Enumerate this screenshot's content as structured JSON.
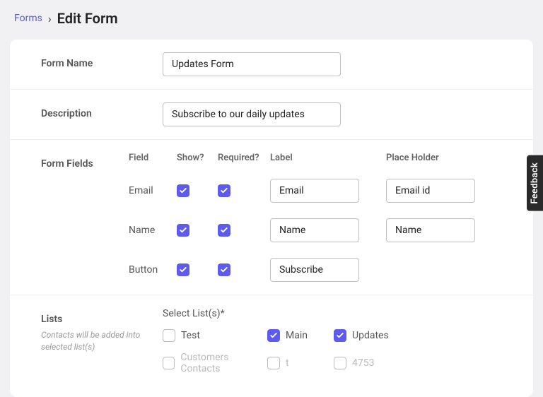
{
  "breadcrumb": {
    "root": "Forms",
    "current": "Edit Form"
  },
  "form_name": {
    "label": "Form Name",
    "value": "Updates Form"
  },
  "description": {
    "label": "Description",
    "value": "Subscribe to our daily updates"
  },
  "form_fields": {
    "section_label": "Form Fields",
    "headers": {
      "field": "Field",
      "show": "Show?",
      "required": "Required?",
      "label": "Label",
      "placeholder": "Place Holder"
    },
    "rows": [
      {
        "field": "Email",
        "show": true,
        "required": true,
        "label": "Email",
        "placeholder": "Email id"
      },
      {
        "field": "Name",
        "show": true,
        "required": true,
        "label": "Name",
        "placeholder": "Name"
      },
      {
        "field": "Button",
        "show": true,
        "required": true,
        "label": "Subscribe",
        "placeholder": ""
      }
    ]
  },
  "lists": {
    "section_label": "Lists",
    "subtext": "Contacts will be added into selected list(s)",
    "head": "Select List(s)*",
    "rows": [
      [
        {
          "label": "Test",
          "checked": false,
          "dim": false
        },
        {
          "label": "Main",
          "checked": true,
          "dim": false
        },
        {
          "label": "Updates",
          "checked": true,
          "dim": false
        }
      ],
      [
        {
          "label": "Customers Contacts",
          "checked": false,
          "dim": true
        },
        {
          "label": "t",
          "checked": false,
          "dim": true
        },
        {
          "label": "4753",
          "checked": false,
          "dim": true
        }
      ]
    ]
  },
  "feedback": {
    "label": "Feedback"
  }
}
